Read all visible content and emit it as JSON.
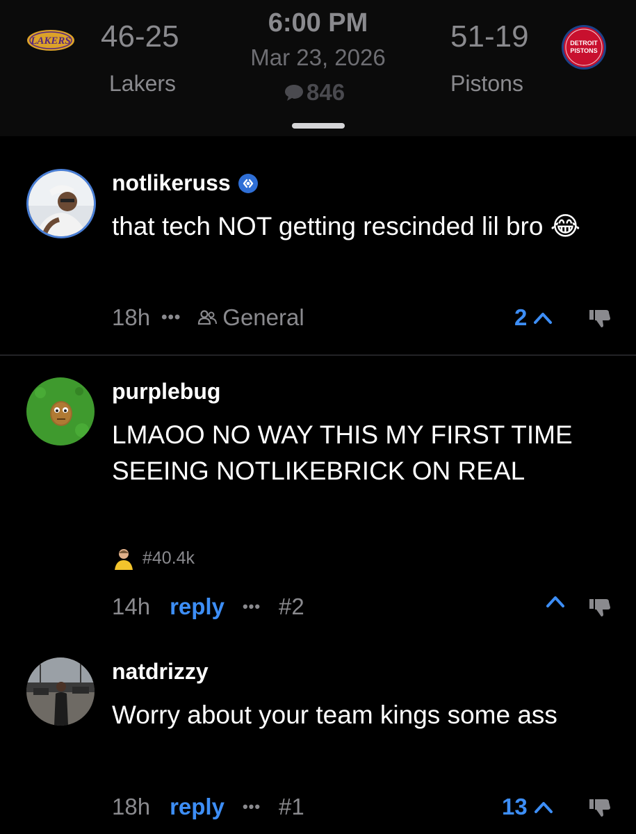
{
  "game": {
    "home_team": "Lakers",
    "home_record": "46-25",
    "away_team": "Pistons",
    "away_record": "51-19",
    "time": "6:00 PM",
    "date": "Mar 23, 2026",
    "comment_count": "846",
    "logos": {
      "home_logo_text": "LAKERS",
      "away_logo_text_1": "DETROIT",
      "away_logo_text_2": "PISTONS"
    }
  },
  "comments": [
    {
      "username": "notlikeruss",
      "verified": true,
      "text": "that tech NOT getting rescinded lil bro 😂",
      "time": "18h",
      "community": "General",
      "upvotes": "2",
      "avatar_icon": "user-avatar-photo"
    },
    {
      "username": "purplebug",
      "text": "LMAOO NO WAY THIS MY FIRST TIME SEEING NOTLIKEBRICK ON REAL",
      "badge": "#40.4k",
      "time": "14h",
      "reply_label": "reply",
      "post_number": "#2",
      "upvotes": "",
      "avatar_icon": "wallnut-avatar"
    },
    {
      "username": "natdrizzy",
      "text": "Worry about your team kings some ass",
      "time": "18h",
      "reply_label": "reply",
      "post_number": "#1",
      "upvotes": "13",
      "avatar_icon": "user-avatar-photo"
    }
  ],
  "colors": {
    "background": "#000000",
    "accent_blue": "#3d8ef6",
    "muted_text": "#8a8a8e",
    "lakers_gold": "#f3b32c",
    "lakers_purple": "#55267f",
    "pistons_red": "#c8102e",
    "pistons_blue": "#1d428a"
  }
}
